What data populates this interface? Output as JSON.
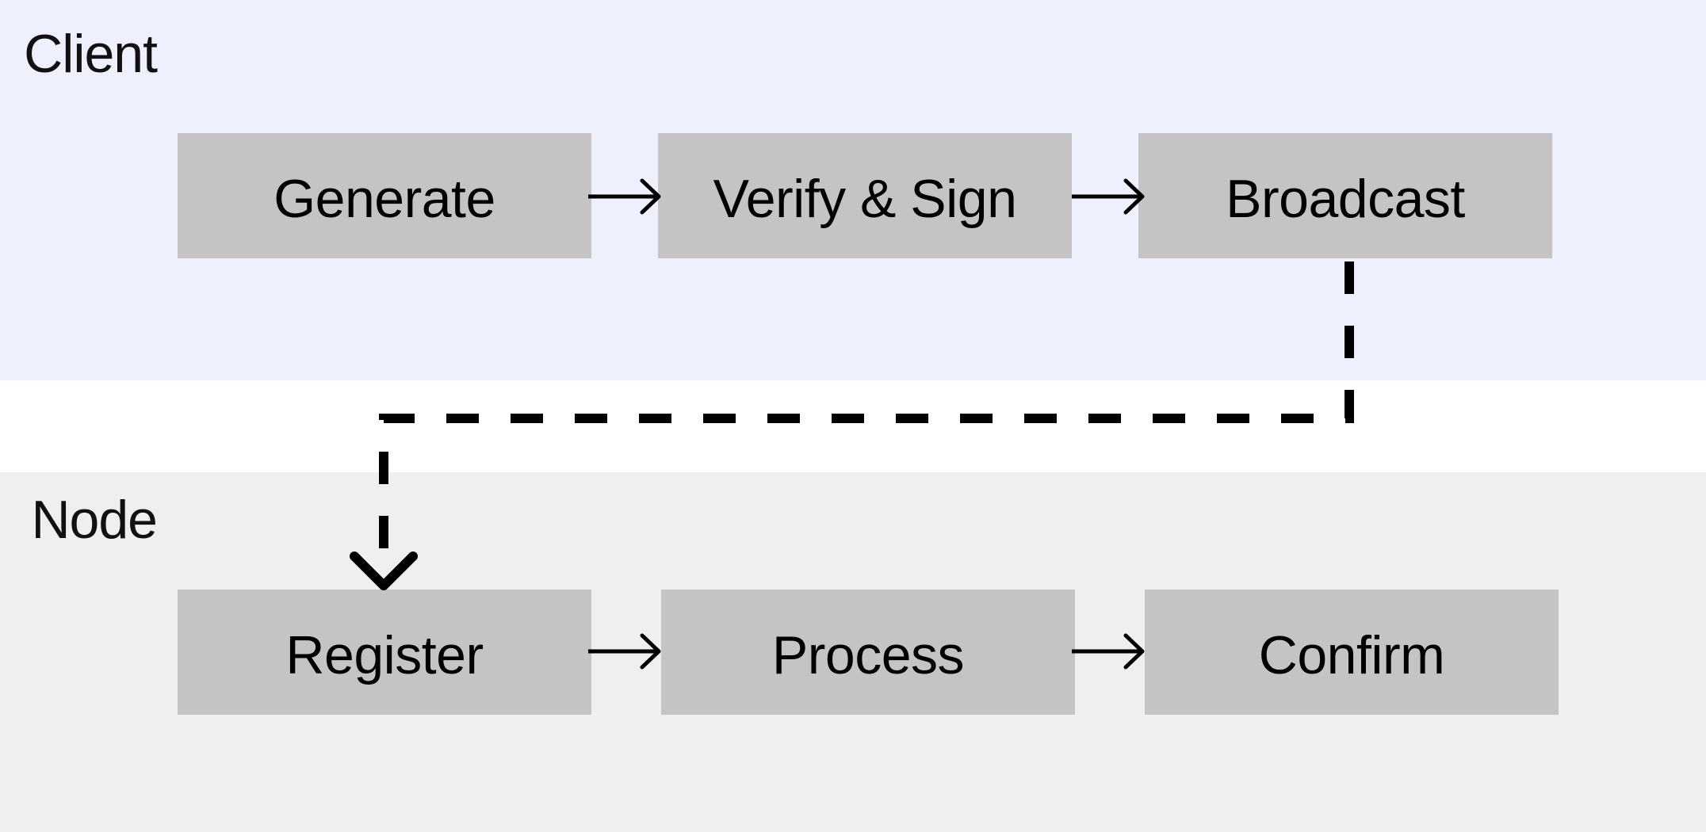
{
  "lanes": {
    "client": {
      "label": "Client",
      "color": "#eef0fd"
    },
    "node": {
      "label": "Node",
      "color": "#efefef"
    }
  },
  "client_steps": [
    {
      "id": "generate",
      "label": "Generate"
    },
    {
      "id": "verify-sign",
      "label": "Verify & Sign"
    },
    {
      "id": "broadcast",
      "label": "Broadcast"
    }
  ],
  "node_steps": [
    {
      "id": "register",
      "label": "Register"
    },
    {
      "id": "process",
      "label": "Process"
    },
    {
      "id": "confirm",
      "label": "Confirm"
    }
  ],
  "edges": [
    {
      "from": "generate",
      "to": "verify-sign",
      "style": "solid"
    },
    {
      "from": "verify-sign",
      "to": "broadcast",
      "style": "solid"
    },
    {
      "from": "broadcast",
      "to": "register",
      "style": "dashed"
    },
    {
      "from": "register",
      "to": "process",
      "style": "solid"
    },
    {
      "from": "process",
      "to": "confirm",
      "style": "solid"
    }
  ],
  "colors": {
    "box": "#c4c4c4",
    "edge": "#000000"
  }
}
